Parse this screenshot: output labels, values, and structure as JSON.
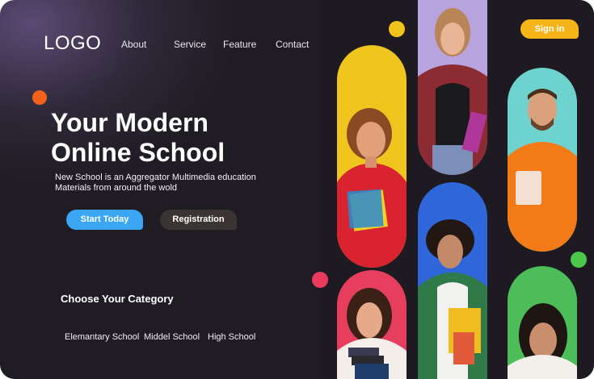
{
  "header": {
    "logo": "LOGO",
    "nav": [
      {
        "label": "About"
      },
      {
        "label": "Service"
      },
      {
        "label": "Feature"
      },
      {
        "label": "Contact"
      }
    ],
    "signin_label": "Sign in"
  },
  "hero": {
    "title_line1": "Your Modern",
    "title_line2": "Online School",
    "subtitle": "New School is an Aggregator Multimedia education Materials from around the wold",
    "start_label": "Start Today",
    "register_label": "Registration"
  },
  "categories": {
    "title": "Choose Your Category",
    "items": [
      {
        "label": "Elemantary School"
      },
      {
        "label": "Middel School"
      },
      {
        "label": "High School"
      }
    ]
  },
  "colors": {
    "accent_yellow": "#f5b417",
    "accent_blue": "#3aa6f4",
    "dot_orange": "#f2621d",
    "dot_yellow": "#f0c21a",
    "dot_pink": "#ea3a5e",
    "dot_green": "#4cc74a"
  },
  "photos": [
    {
      "subject": "student-red-hoodie",
      "bg": "#f0c51e"
    },
    {
      "subject": "student-plaid-shirt",
      "bg": "#b7a3de"
    },
    {
      "subject": "student-orange-sweater",
      "bg": "#6ed3cf"
    },
    {
      "subject": "student-curly-hair",
      "bg": "#2f66d9"
    },
    {
      "subject": "student-books",
      "bg": "#e63e5c"
    },
    {
      "subject": "student-green-bg",
      "bg": "#4cbd58"
    }
  ]
}
